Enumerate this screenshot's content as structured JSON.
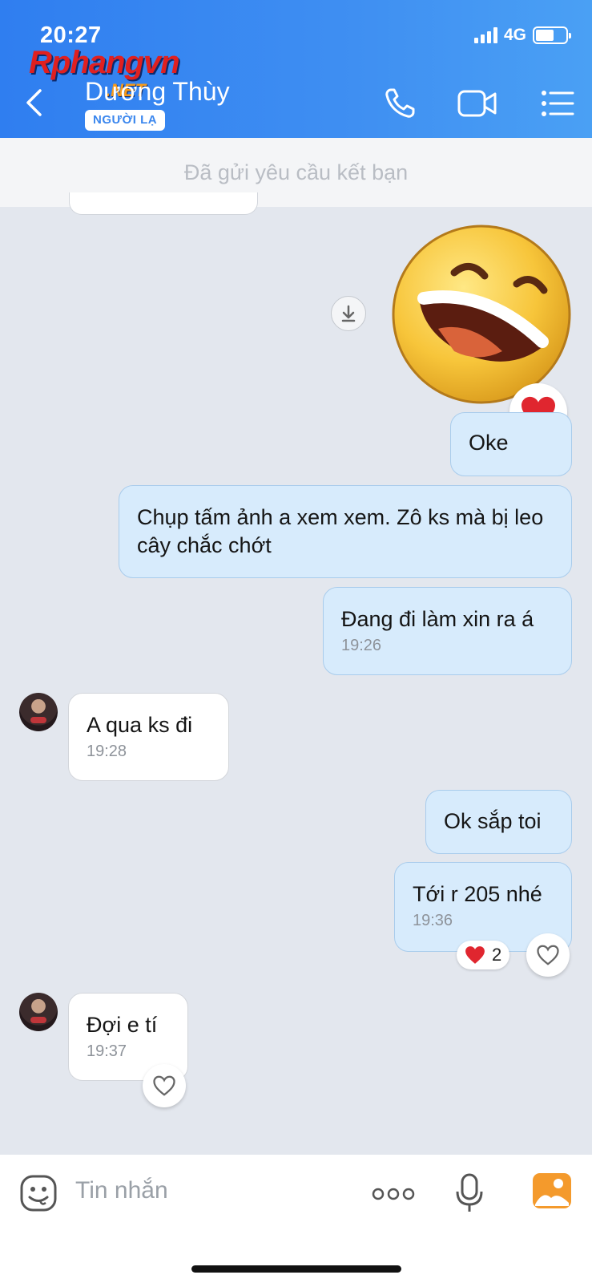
{
  "status_bar": {
    "time": "20:27",
    "network": "4G",
    "battery_level": 0.6
  },
  "watermark": {
    "text": "Rphangvn",
    "suffix": ".NET"
  },
  "header": {
    "contact_name": "Dương Thùy",
    "badge": "NGƯỜI LẠ"
  },
  "request_notice": "Đã gửi yêu cầu kết bạn",
  "messages": [
    {
      "from": "me",
      "type": "sticker",
      "sticker": "laughing-emoji",
      "reaction": "heart"
    },
    {
      "from": "me",
      "text": "Oke"
    },
    {
      "from": "me",
      "text": "Chụp tấm ảnh a xem xem. Zô ks mà bị leo cây chắc chớt"
    },
    {
      "from": "me",
      "text": "Đang đi làm xin ra á",
      "time": "19:26"
    },
    {
      "from": "them",
      "text": "A qua ks đi",
      "time": "19:28"
    },
    {
      "from": "me",
      "text": "Ok sắp toi"
    },
    {
      "from": "me",
      "text": "Tới r 205 nhé",
      "time": "19:36",
      "reaction_count": "2"
    },
    {
      "from": "them",
      "text": "Đợi e tí",
      "time": "19:37"
    }
  ],
  "input": {
    "placeholder": "Tin nhắn"
  },
  "colors": {
    "header_blue": "#3b87ee",
    "my_bubble": "#d7ebfc",
    "their_bubble": "#ffffff",
    "heart_red": "#e0262f",
    "chat_bg": "#e3e7ee"
  }
}
